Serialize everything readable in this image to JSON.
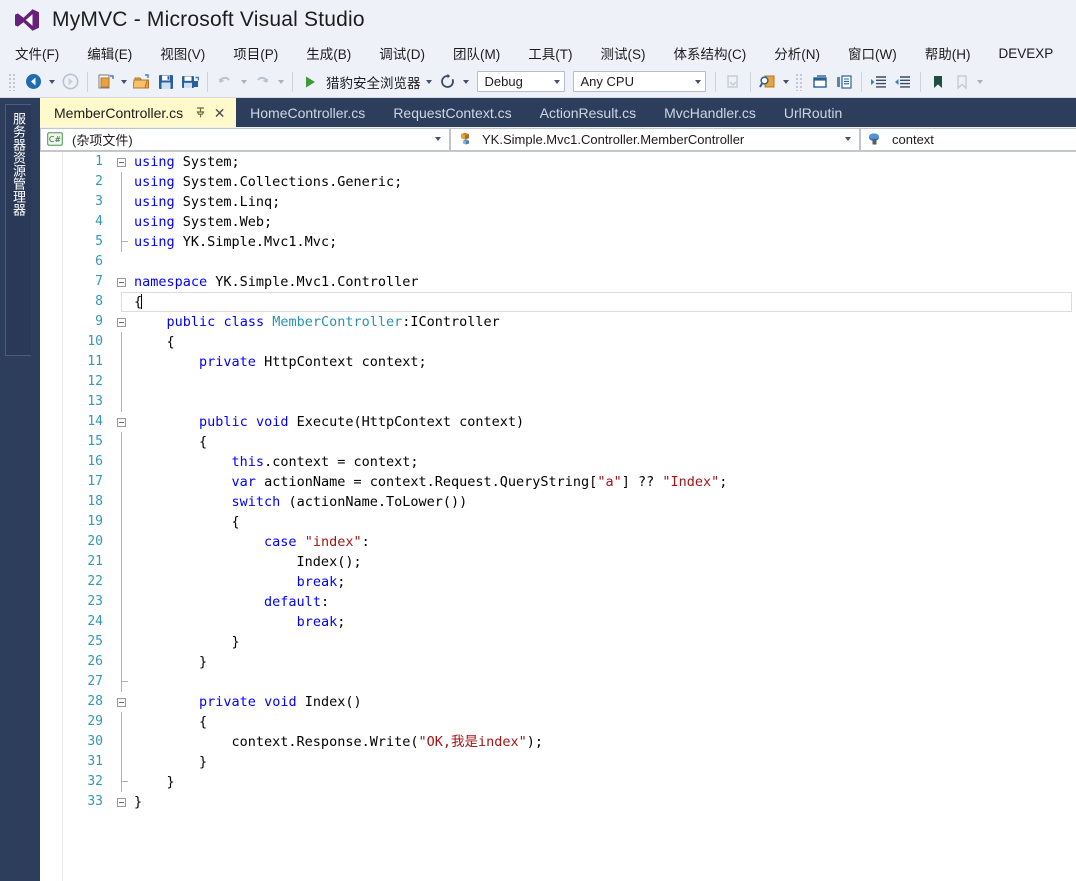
{
  "window": {
    "title": "MyMVC - Microsoft Visual Studio",
    "logo_icon": "visual-studio-logo"
  },
  "menubar": {
    "items": [
      {
        "label": "文件(F)",
        "mnemonic": "F"
      },
      {
        "label": "编辑(E)",
        "mnemonic": "E"
      },
      {
        "label": "视图(V)",
        "mnemonic": "V"
      },
      {
        "label": "项目(P)",
        "mnemonic": "P"
      },
      {
        "label": "生成(B)",
        "mnemonic": "B"
      },
      {
        "label": "调试(D)",
        "mnemonic": "D"
      },
      {
        "label": "团队(M)",
        "mnemonic": "M"
      },
      {
        "label": "工具(T)",
        "mnemonic": "T"
      },
      {
        "label": "测试(S)",
        "mnemonic": "S"
      },
      {
        "label": "体系结构(C)",
        "mnemonic": "C"
      },
      {
        "label": "分析(N)",
        "mnemonic": "N"
      },
      {
        "label": "窗口(W)",
        "mnemonic": "W"
      },
      {
        "label": "帮助(H)",
        "mnemonic": "H"
      },
      {
        "label": "DEVEXP",
        "mnemonic": ""
      }
    ]
  },
  "toolbar": {
    "navigate_back_icon": "arrow-back-icon",
    "navigate_forward_icon": "arrow-forward-icon",
    "new_project_icon": "new-project-icon",
    "open_file_icon": "open-folder-icon",
    "save_icon": "save-icon",
    "save_all_icon": "save-all-icon",
    "undo_icon": "undo-icon",
    "redo_icon": "redo-icon",
    "start_icon": "start-debug-play-icon",
    "start_label": "猎豹安全浏览器",
    "refresh_icon": "refresh-icon",
    "configuration": "Debug",
    "platform": "Any CPU",
    "step_icon": "step-into-icon",
    "find_icon": "find-in-files-icon",
    "window_icon": "new-window-icon",
    "comment_icon": "comment-selection-icon",
    "indent_icon": "increase-indent-icon",
    "outdent_icon": "decrease-indent-icon",
    "bookmark_icon": "bookmark-icon",
    "nav_bookmark_icon": "next-bookmark-icon"
  },
  "left_rail": {
    "label": "服务器资源管理器"
  },
  "tabs": [
    {
      "label": "MemberController.cs",
      "active": true,
      "pin_icon": "pin-icon",
      "close_icon": "close-icon"
    },
    {
      "label": "HomeController.cs",
      "active": false
    },
    {
      "label": "RequestContext.cs",
      "active": false
    },
    {
      "label": "ActionResult.cs",
      "active": false
    },
    {
      "label": "MvcHandler.cs",
      "active": false
    },
    {
      "label": "UrlRoutin",
      "active": false
    }
  ],
  "navbar": {
    "project": {
      "icon": "csharp-file-icon",
      "value": "(杂项文件)"
    },
    "type": {
      "icon": "class-icon",
      "value": "YK.Simple.Mvc1.Controller.MemberController"
    },
    "member": {
      "icon": "field-private-icon",
      "value": "context"
    }
  },
  "editor": {
    "cursor_line": 8,
    "colors": {
      "keyword": "#0000ff",
      "type": "#2b91af",
      "string": "#a31515",
      "plain": "#000000",
      "line_number": "#2b91af",
      "background": "#ffffff"
    },
    "lines": [
      {
        "n": 1,
        "fold": "start",
        "guide": false,
        "tokens": [
          {
            "t": "using",
            "c": "kw"
          },
          {
            "t": " System;",
            "c": "pl"
          }
        ]
      },
      {
        "n": 2,
        "fold": "none",
        "guide": true,
        "tokens": [
          {
            "t": "using",
            "c": "kw"
          },
          {
            "t": " System.Collections.Generic;",
            "c": "pl"
          }
        ]
      },
      {
        "n": 3,
        "fold": "none",
        "guide": true,
        "tokens": [
          {
            "t": "using",
            "c": "kw"
          },
          {
            "t": " System.Linq;",
            "c": "pl"
          }
        ]
      },
      {
        "n": 4,
        "fold": "none",
        "guide": true,
        "tokens": [
          {
            "t": "using",
            "c": "kw"
          },
          {
            "t": " System.Web;",
            "c": "pl"
          }
        ]
      },
      {
        "n": 5,
        "fold": "end",
        "guide": true,
        "tokens": [
          {
            "t": "using",
            "c": "kw"
          },
          {
            "t": " YK.Simple.Mvc1.Mvc;",
            "c": "pl"
          }
        ]
      },
      {
        "n": 6,
        "fold": "none",
        "guide": false,
        "tokens": []
      },
      {
        "n": 7,
        "fold": "start",
        "guide": false,
        "tokens": [
          {
            "t": "namespace",
            "c": "kw"
          },
          {
            "t": " YK.Simple.Mvc1.Controller",
            "c": "pl"
          }
        ]
      },
      {
        "n": 8,
        "fold": "none",
        "guide": true,
        "tokens": [
          {
            "t": "{",
            "c": "pl"
          }
        ]
      },
      {
        "n": 9,
        "fold": "start",
        "guide": true,
        "tokens": [
          {
            "t": "    ",
            "c": "pl"
          },
          {
            "t": "public",
            "c": "kw"
          },
          {
            "t": " ",
            "c": "pl"
          },
          {
            "t": "class",
            "c": "kw"
          },
          {
            "t": " ",
            "c": "pl"
          },
          {
            "t": "MemberController",
            "c": "ty"
          },
          {
            "t": ":IController",
            "c": "pl"
          }
        ]
      },
      {
        "n": 10,
        "fold": "none",
        "guide": true,
        "tokens": [
          {
            "t": "    {",
            "c": "pl"
          }
        ]
      },
      {
        "n": 11,
        "fold": "none",
        "guide": true,
        "tokens": [
          {
            "t": "        ",
            "c": "pl"
          },
          {
            "t": "private",
            "c": "kw"
          },
          {
            "t": " HttpContext context;",
            "c": "pl"
          }
        ]
      },
      {
        "n": 12,
        "fold": "none",
        "guide": true,
        "tokens": []
      },
      {
        "n": 13,
        "fold": "none",
        "guide": true,
        "tokens": []
      },
      {
        "n": 14,
        "fold": "start",
        "guide": true,
        "tokens": [
          {
            "t": "        ",
            "c": "pl"
          },
          {
            "t": "public",
            "c": "kw"
          },
          {
            "t": " ",
            "c": "pl"
          },
          {
            "t": "void",
            "c": "kw"
          },
          {
            "t": " Execute(HttpContext context)",
            "c": "pl"
          }
        ]
      },
      {
        "n": 15,
        "fold": "none",
        "guide": true,
        "tokens": [
          {
            "t": "        {",
            "c": "pl"
          }
        ]
      },
      {
        "n": 16,
        "fold": "none",
        "guide": true,
        "tokens": [
          {
            "t": "            ",
            "c": "pl"
          },
          {
            "t": "this",
            "c": "kw"
          },
          {
            "t": ".context = context;",
            "c": "pl"
          }
        ]
      },
      {
        "n": 17,
        "fold": "none",
        "guide": true,
        "tokens": [
          {
            "t": "            ",
            "c": "pl"
          },
          {
            "t": "var",
            "c": "kw"
          },
          {
            "t": " actionName = context.Request.QueryString[",
            "c": "pl"
          },
          {
            "t": "\"a\"",
            "c": "st"
          },
          {
            "t": "] ?? ",
            "c": "pl"
          },
          {
            "t": "\"Index\"",
            "c": "st"
          },
          {
            "t": ";",
            "c": "pl"
          }
        ]
      },
      {
        "n": 18,
        "fold": "none",
        "guide": true,
        "tokens": [
          {
            "t": "            ",
            "c": "pl"
          },
          {
            "t": "switch",
            "c": "kw"
          },
          {
            "t": " (actionName.ToLower())",
            "c": "pl"
          }
        ]
      },
      {
        "n": 19,
        "fold": "none",
        "guide": true,
        "tokens": [
          {
            "t": "            {",
            "c": "pl"
          }
        ]
      },
      {
        "n": 20,
        "fold": "none",
        "guide": true,
        "tokens": [
          {
            "t": "                ",
            "c": "pl"
          },
          {
            "t": "case",
            "c": "kw"
          },
          {
            "t": " ",
            "c": "pl"
          },
          {
            "t": "\"index\"",
            "c": "st"
          },
          {
            "t": ":",
            "c": "pl"
          }
        ]
      },
      {
        "n": 21,
        "fold": "none",
        "guide": true,
        "tokens": [
          {
            "t": "                    Index();",
            "c": "pl"
          }
        ]
      },
      {
        "n": 22,
        "fold": "none",
        "guide": true,
        "tokens": [
          {
            "t": "                    ",
            "c": "pl"
          },
          {
            "t": "break",
            "c": "kw"
          },
          {
            "t": ";",
            "c": "pl"
          }
        ]
      },
      {
        "n": 23,
        "fold": "none",
        "guide": true,
        "tokens": [
          {
            "t": "                ",
            "c": "pl"
          },
          {
            "t": "default",
            "c": "kw"
          },
          {
            "t": ":",
            "c": "pl"
          }
        ]
      },
      {
        "n": 24,
        "fold": "none",
        "guide": true,
        "tokens": [
          {
            "t": "                    ",
            "c": "pl"
          },
          {
            "t": "break",
            "c": "kw"
          },
          {
            "t": ";",
            "c": "pl"
          }
        ]
      },
      {
        "n": 25,
        "fold": "none",
        "guide": true,
        "tokens": [
          {
            "t": "            }",
            "c": "pl"
          }
        ]
      },
      {
        "n": 26,
        "fold": "none",
        "guide": true,
        "tokens": [
          {
            "t": "        }",
            "c": "pl"
          }
        ]
      },
      {
        "n": 27,
        "fold": "dash",
        "guide": true,
        "tokens": []
      },
      {
        "n": 28,
        "fold": "start",
        "guide": true,
        "tokens": [
          {
            "t": "        ",
            "c": "pl"
          },
          {
            "t": "private",
            "c": "kw"
          },
          {
            "t": " ",
            "c": "pl"
          },
          {
            "t": "void",
            "c": "kw"
          },
          {
            "t": " Index()",
            "c": "pl"
          }
        ]
      },
      {
        "n": 29,
        "fold": "none",
        "guide": true,
        "tokens": [
          {
            "t": "        {",
            "c": "pl"
          }
        ]
      },
      {
        "n": 30,
        "fold": "none",
        "guide": true,
        "tokens": [
          {
            "t": "            context.Response.Write(",
            "c": "pl"
          },
          {
            "t": "\"OK,我是index\"",
            "c": "st"
          },
          {
            "t": ");",
            "c": "pl"
          }
        ]
      },
      {
        "n": 31,
        "fold": "none",
        "guide": true,
        "tokens": [
          {
            "t": "        }",
            "c": "pl"
          }
        ]
      },
      {
        "n": 32,
        "fold": "dash",
        "guide": true,
        "tokens": [
          {
            "t": "    }",
            "c": "pl"
          }
        ]
      },
      {
        "n": 33,
        "fold": "endc",
        "guide": false,
        "tokens": [
          {
            "t": "}",
            "c": "pl"
          }
        ]
      }
    ]
  }
}
